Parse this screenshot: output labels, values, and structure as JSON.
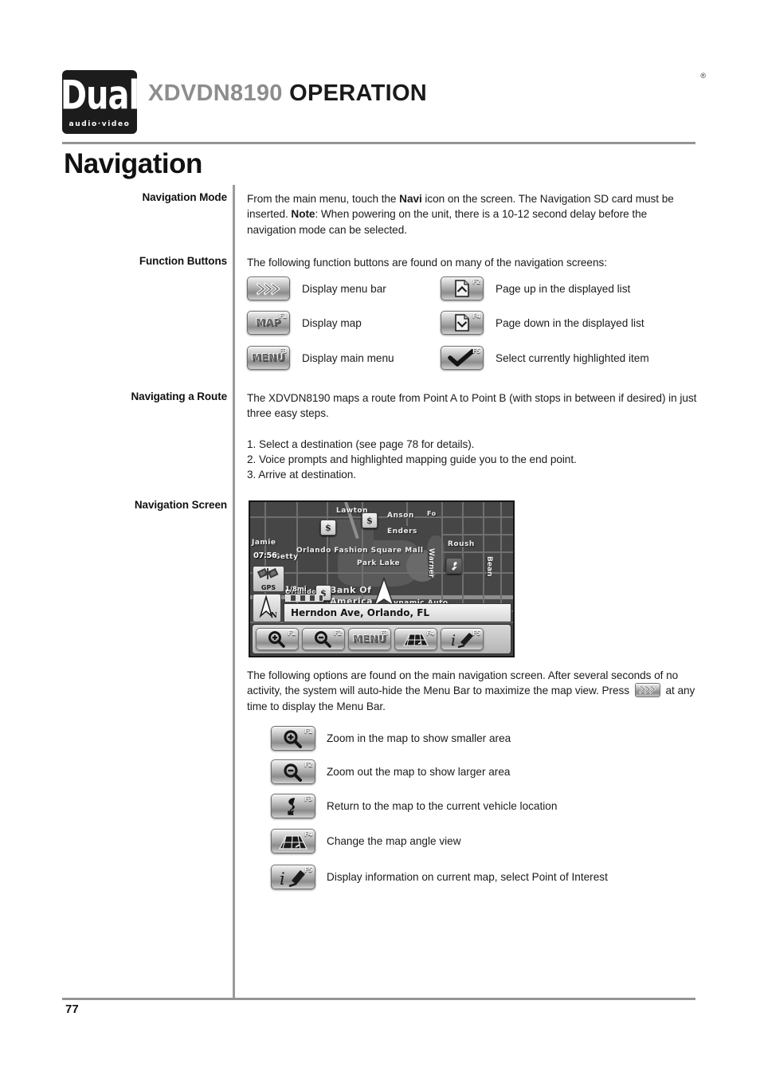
{
  "header": {
    "logo_word": "Dual",
    "logo_sub": "audio·video",
    "logo_trademark": "®",
    "model": "XDVDN8190",
    "section": "OPERATION"
  },
  "chapter_title": "Navigation",
  "sections": {
    "navigation_mode": {
      "label": "Navigation Mode",
      "text_1": "From the main menu, touch the ",
      "bold_1": "Navi",
      "text_2": " icon on the screen. The Navigation SD card must be inserted. ",
      "bold_2": "Note",
      "text_3": ": When powering on the unit, there is a 10-12 second delay before the navigation mode can be selected."
    },
    "function_buttons": {
      "label": "Function Buttons",
      "intro": "The following function buttons are found on many of the navigation screens:",
      "buttons_left": [
        {
          "icon": "chevron-double-right-icon",
          "fkey": "",
          "word": "",
          "text": "Display menu bar"
        },
        {
          "icon": "map-label-icon",
          "fkey": "F1",
          "word": "MAP",
          "text": "Display map"
        },
        {
          "icon": "menu-label-icon",
          "fkey": "F3",
          "word": "MENU",
          "text": "Display main menu"
        }
      ],
      "buttons_right": [
        {
          "icon": "page-up-icon",
          "fkey": "F2",
          "word": "",
          "text": "Page up in the displayed list"
        },
        {
          "icon": "page-down-icon",
          "fkey": "F4",
          "word": "",
          "text": "Page down in the displayed list"
        },
        {
          "icon": "checkmark-icon",
          "fkey": "F5",
          "word": "",
          "text": "Select currently highlighted item"
        }
      ]
    },
    "navigating_route": {
      "label": "Navigating a Route",
      "intro": "The XDVDN8190 maps a route from Point A to Point B (with stops in between if desired) in just three easy steps.",
      "steps": [
        "1. Select a destination (see page 78 for details).",
        "2. Voice prompts and highlighted mapping guide you to the end point.",
        "3. Arrive at destination."
      ]
    },
    "navigation_screen": {
      "label": "Navigation Screen",
      "after_text_1": "The following options are found on the main navigation screen. After several seconds of no activity, the system will auto-hide the Menu Bar to maximize the map view. Press ",
      "after_text_2": " at any time to display the Menu Bar.",
      "options": [
        {
          "icon": "zoom-in-icon",
          "fkey": "F1",
          "text": "Zoom in the map to show smaller area"
        },
        {
          "icon": "zoom-out-icon",
          "fkey": "F2",
          "text": "Zoom out the map to show larger area"
        },
        {
          "icon": "current-location-icon",
          "fkey": "F3",
          "text": "Return to the map to the current vehicle location"
        },
        {
          "icon": "map-angle-icon",
          "fkey": "F4",
          "text": "Change the map angle view"
        },
        {
          "icon": "info-pin-icon",
          "fkey": "F5",
          "text": "Display information on current map, select Point of Interest"
        }
      ]
    }
  },
  "nav_screen_mock": {
    "clock": "07:56",
    "gps_label": "GPS",
    "compass_label": "N",
    "scale_label": "1/8mi",
    "address": "Herndon Ave, Orlando, FL",
    "map_labels": [
      "Lawton",
      "Anson",
      "Enders",
      "Roush",
      "Jamie",
      "Getty",
      "Orlando Fashion Square Mall",
      "Park Lake",
      "Bank Of",
      "America",
      "Dynamic Auto",
      "Warner",
      "Bean",
      "Orlando",
      "Fo"
    ],
    "poi_markers": [
      "$",
      "$",
      "$",
      "wrench"
    ],
    "menu_buttons": [
      {
        "icon": "zoom-in-icon",
        "fkey": "F1",
        "word": ""
      },
      {
        "icon": "zoom-out-icon",
        "fkey": "F2",
        "word": ""
      },
      {
        "icon": "menu-label-icon",
        "fkey": "F3",
        "word": "MENU"
      },
      {
        "icon": "map-angle-icon",
        "fkey": "F4",
        "word": ""
      },
      {
        "icon": "info-pin-icon",
        "fkey": "F5",
        "word": ""
      }
    ]
  },
  "footer": {
    "page_number": "77"
  },
  "colors": {
    "rule": "#949494",
    "model_gray": "#8d8d8d",
    "ink": "#1a1a1a"
  }
}
